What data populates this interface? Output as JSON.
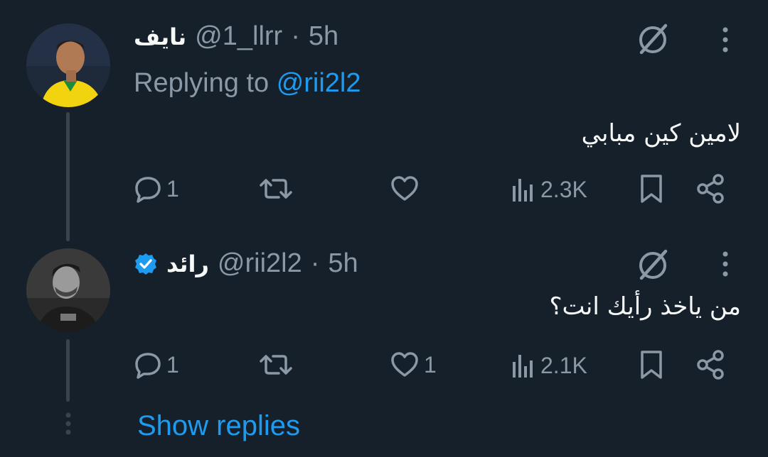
{
  "tweets": [
    {
      "name": "نايف",
      "handle": "@1_llrr",
      "time": "5h",
      "replying_prefix": "Replying to",
      "replying_mention": "@rii2l2",
      "text": "لامين كين مبابي",
      "replies": "1",
      "retweets": "",
      "likes": "",
      "views": "2.3K",
      "verified": false
    },
    {
      "name": "رائد",
      "handle": "@rii2l2",
      "time": "5h",
      "text": "من ياخذ رأيك انت؟",
      "replies": "1",
      "retweets": "",
      "likes": "1",
      "views": "2.1K",
      "verified": true
    }
  ],
  "separator": "·",
  "show_replies": "Show replies",
  "colors": {
    "background": "#15202b",
    "accent": "#1d9bf0",
    "muted": "#8b98a5",
    "text": "#f7f9f9"
  },
  "icons": [
    "grok-icon",
    "more-icon",
    "reply-icon",
    "retweet-icon",
    "like-icon",
    "views-icon",
    "bookmark-icon",
    "share-icon",
    "verified-badge-icon"
  ]
}
